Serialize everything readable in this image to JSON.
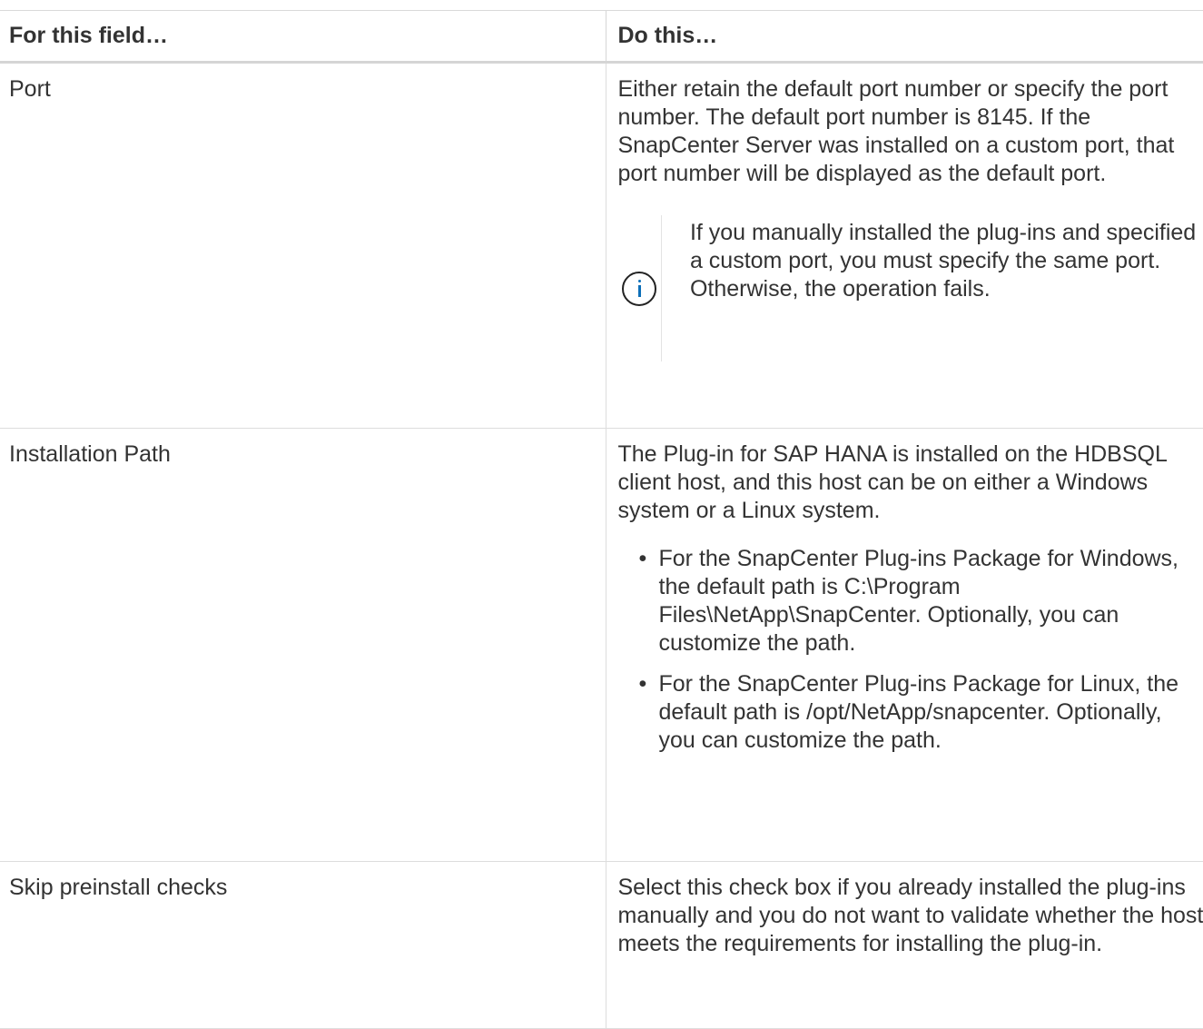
{
  "table": {
    "headers": [
      "For this field…",
      "Do this…"
    ],
    "rows": {
      "port": {
        "field": "Port",
        "description": "Either retain the default port number or specify the port number. The default port number is 8145. If the SnapCenter Server was installed on a custom port, that port number will be displayed as the default port.",
        "note": "If you manually installed the plug-ins and specified a custom port, you must specify the same port. Otherwise, the operation fails."
      },
      "installation_path": {
        "field": "Installation Path",
        "description": "The Plug-in for SAP HANA is installed on the HDBSQL client host, and this host can be on either a Windows system or a Linux system.",
        "bullets": [
          "For the SnapCenter Plug-ins Package for Windows, the default path is C:\\Program Files\\NetApp\\SnapCenter. Optionally, you can customize the path.",
          "For the SnapCenter Plug-ins Package for Linux, the default path is /opt/NetApp/snapcenter. Optionally, you can customize the path."
        ]
      },
      "skip_checks": {
        "field": "Skip preinstall checks",
        "description": "Select this check box if you already installed the plug-ins manually and you do not want to validate whether the host meets the requirements for installing the plug-in."
      }
    }
  },
  "icons": {
    "note_icon": "info-circle-icon",
    "bullet": "•"
  },
  "colors": {
    "text": "#333333",
    "icon_accent": "#0d6fb8",
    "border": "#dddddd"
  }
}
